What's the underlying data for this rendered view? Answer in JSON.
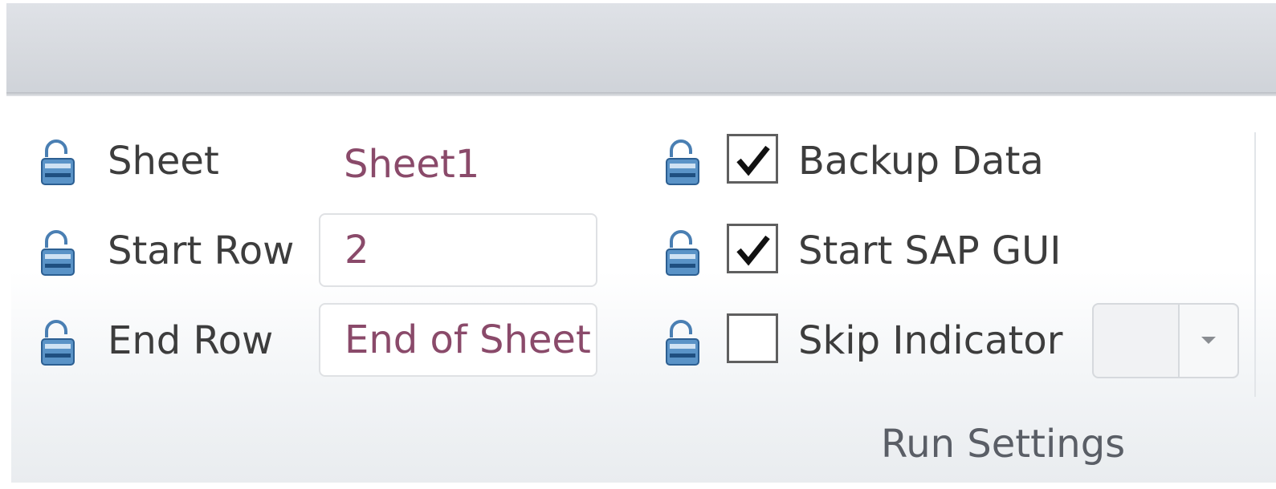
{
  "ribbon_group": {
    "caption": "Run Settings",
    "rows": [
      {
        "label": "Sheet",
        "value": "Sheet1",
        "locked": false,
        "lock_icon": "unlock-icon"
      },
      {
        "label": "Start Row",
        "value": "2",
        "locked": false,
        "lock_icon": "unlock-icon"
      },
      {
        "label": "End Row",
        "value": "End of Sheet",
        "locked": false,
        "lock_icon": "unlock-icon"
      }
    ],
    "options": [
      {
        "label": "Backup Data",
        "checked": true,
        "lock_icon": "unlock-icon"
      },
      {
        "label": "Start SAP GUI",
        "checked": true,
        "lock_icon": "unlock-icon"
      },
      {
        "label": "Skip Indicator",
        "checked": false,
        "lock_icon": "unlock-icon"
      }
    ],
    "skip_indicator_select": {
      "selected": "",
      "icon": "chevron-down-icon"
    }
  },
  "colors": {
    "value_text": "#8a4a6a",
    "label_text": "#3d3d3d",
    "caption_text": "#5a5e66",
    "lock_blue": "#2f6fa8"
  }
}
